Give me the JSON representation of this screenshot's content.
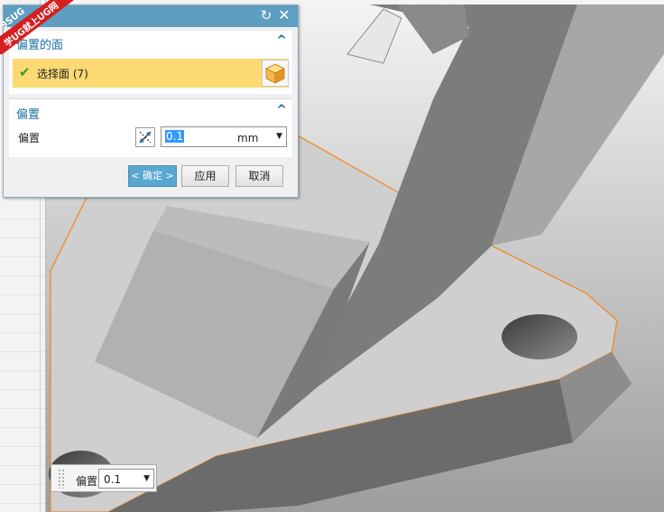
{
  "dialog": {
    "title": "",
    "faces_group": {
      "title": "偏置的面",
      "select_label": "选择面 (7)"
    },
    "offset_group": {
      "title": "偏置",
      "field_label": "偏置",
      "value": "0.1",
      "unit": "mm"
    },
    "buttons": {
      "ok": "< 确定 >",
      "apply": "应用",
      "cancel": "取消"
    }
  },
  "watermark": {
    "line1": "9SUG",
    "line2": "学UG就上UG网"
  },
  "float_toolbar": {
    "label": "偏置",
    "value": "0.1"
  },
  "colors": {
    "accent": "#5e9ec0",
    "highlight": "#fcd973",
    "edge": "#f08a24"
  }
}
